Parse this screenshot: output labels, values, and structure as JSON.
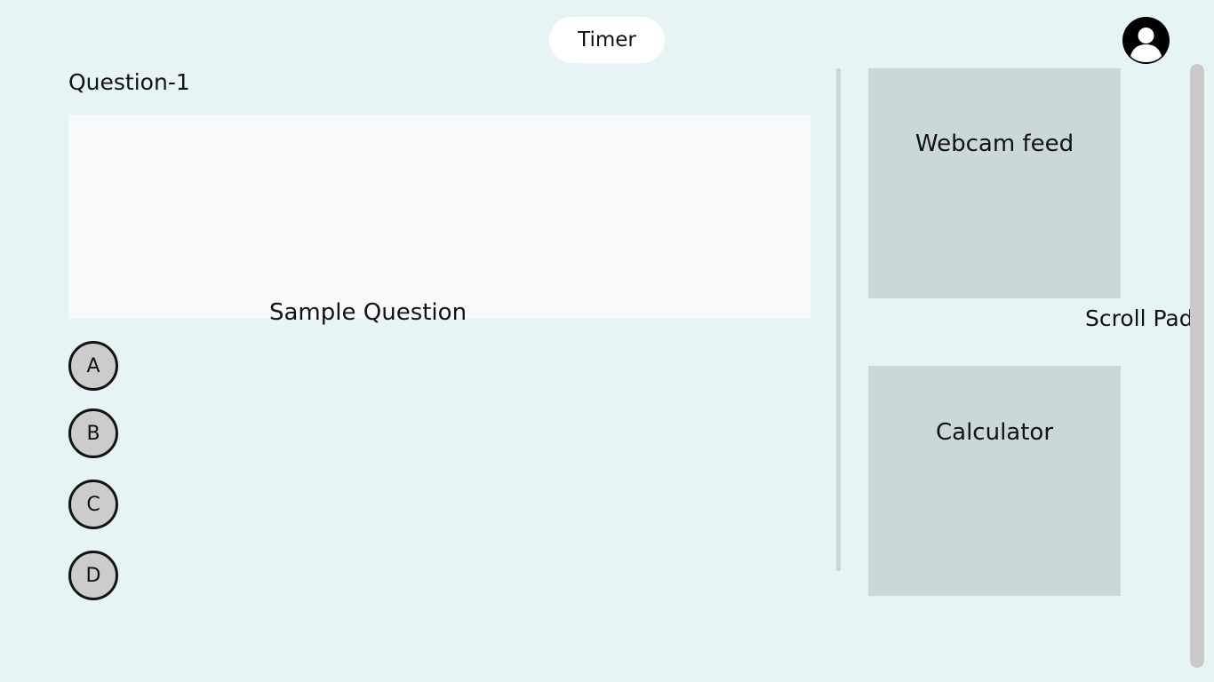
{
  "header": {
    "timer_label": "Timer",
    "avatar_icon": "user-avatar-icon"
  },
  "question": {
    "heading": "Question-1",
    "text": "Sample Question"
  },
  "options": [
    {
      "label": "A"
    },
    {
      "label": "B"
    },
    {
      "label": "C"
    },
    {
      "label": "D"
    }
  ],
  "side_panel": {
    "webcam_label": "Webcam feed",
    "calculator_label": "Calculator",
    "scroll_pad_label": "Scroll Pad"
  },
  "colors": {
    "background": "#e6f4f5",
    "question_box": "#f7f9fb",
    "panel": "#cad8d8",
    "option_fill": "#cccccc",
    "scrollbar": "#cacaca"
  }
}
